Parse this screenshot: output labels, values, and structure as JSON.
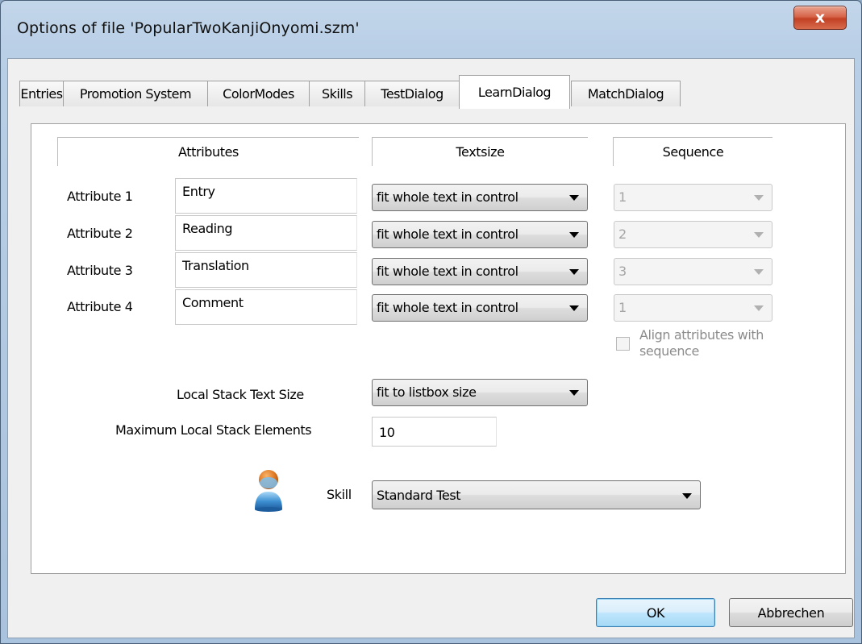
{
  "window": {
    "title": "Options of file 'PopularTwoKanjiOnyomi.szm'",
    "close_symbol": "x"
  },
  "tabs": [
    {
      "label": "Entries"
    },
    {
      "label": "Promotion System"
    },
    {
      "label": "ColorModes"
    },
    {
      "label": "Skills"
    },
    {
      "label": "TestDialog"
    },
    {
      "label": "LearnDialog",
      "active": true
    },
    {
      "label": "MatchDialog"
    }
  ],
  "headers": {
    "attributes": "Attributes",
    "textsize": "Textsize",
    "sequence": "Sequence"
  },
  "rows": [
    {
      "label": "Attribute 1",
      "value": "Entry",
      "textsize": "fit whole text in control",
      "sequence": "1"
    },
    {
      "label": "Attribute 2",
      "value": "Reading",
      "textsize": "fit whole text in control",
      "sequence": "2"
    },
    {
      "label": "Attribute 3",
      "value": "Translation",
      "textsize": "fit whole text in control",
      "sequence": "3"
    },
    {
      "label": "Attribute 4",
      "value": "Comment",
      "textsize": "fit whole text in control",
      "sequence": "1"
    }
  ],
  "align": {
    "label_line1": "Align attributes with",
    "label_line2": "sequence",
    "checked": false
  },
  "local_stack": {
    "label": "Local Stack Text Size",
    "value": "fit to listbox size"
  },
  "max_elements": {
    "label": "Maximum Local Stack Elements",
    "value": "10"
  },
  "skill": {
    "label": "Skill",
    "value": "Standard Test",
    "icon": "user-icon"
  },
  "buttons": {
    "ok": "OK",
    "cancel": "Abbrechen"
  }
}
